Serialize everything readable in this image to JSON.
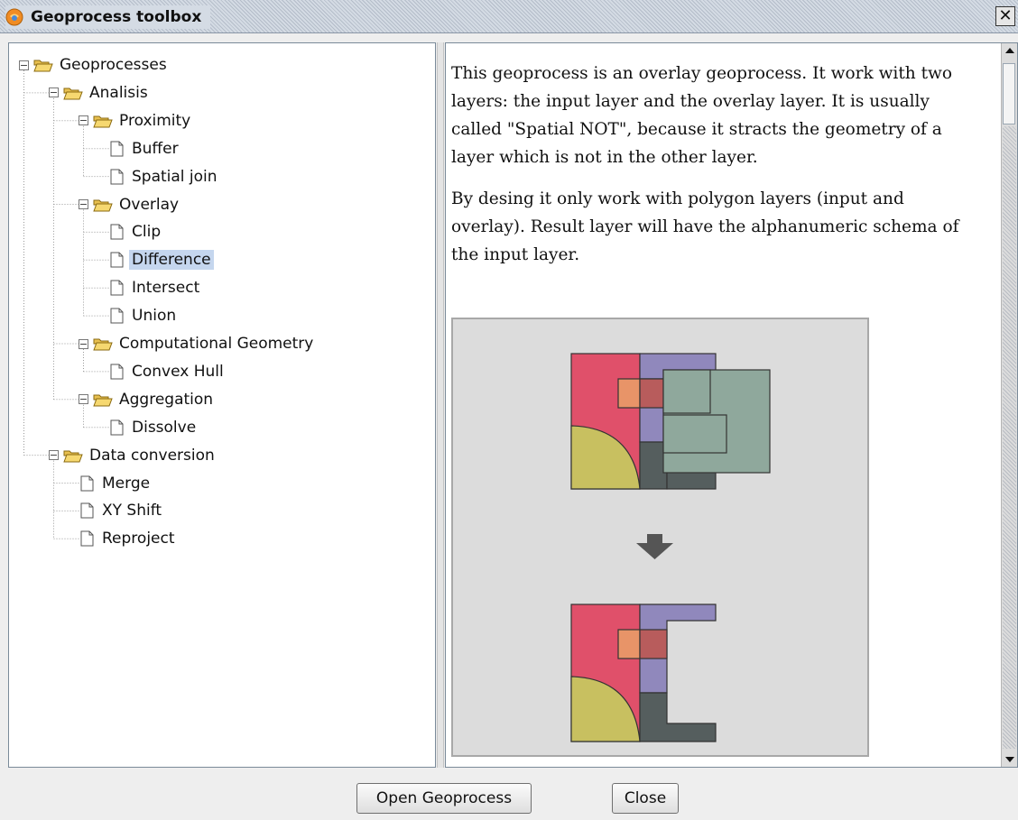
{
  "window": {
    "title": "Geoprocess toolbox",
    "close_glyph": "✕"
  },
  "tree": [
    {
      "id": "geoprocesses",
      "label": "Geoprocesses",
      "kind": "folder",
      "level": 0,
      "expanded": true
    },
    {
      "id": "analisis",
      "label": "Analisis",
      "kind": "folder",
      "level": 1,
      "expanded": true
    },
    {
      "id": "proximity",
      "label": "Proximity",
      "kind": "folder",
      "level": 2,
      "expanded": true
    },
    {
      "id": "buffer",
      "label": "Buffer",
      "kind": "leaf",
      "level": 3
    },
    {
      "id": "spatial-join",
      "label": "Spatial join",
      "kind": "leaf",
      "level": 3
    },
    {
      "id": "overlay",
      "label": "Overlay",
      "kind": "folder",
      "level": 2,
      "expanded": true
    },
    {
      "id": "clip",
      "label": "Clip",
      "kind": "leaf",
      "level": 3
    },
    {
      "id": "difference",
      "label": "Difference",
      "kind": "leaf",
      "level": 3,
      "selected": true
    },
    {
      "id": "intersect",
      "label": "Intersect",
      "kind": "leaf",
      "level": 3
    },
    {
      "id": "union",
      "label": "Union",
      "kind": "leaf",
      "level": 3
    },
    {
      "id": "computational-geometry",
      "label": "Computational Geometry",
      "kind": "folder",
      "level": 2,
      "expanded": true
    },
    {
      "id": "convex-hull",
      "label": "Convex Hull",
      "kind": "leaf",
      "level": 3
    },
    {
      "id": "aggregation",
      "label": "Aggregation",
      "kind": "folder",
      "level": 2,
      "expanded": true
    },
    {
      "id": "dissolve",
      "label": "Dissolve",
      "kind": "leaf",
      "level": 3
    },
    {
      "id": "data-conversion",
      "label": "Data conversion",
      "kind": "folder",
      "level": 1,
      "expanded": true
    },
    {
      "id": "merge",
      "label": "Merge",
      "kind": "leaf",
      "level": 2
    },
    {
      "id": "xy-shift",
      "label": "XY Shift",
      "kind": "leaf",
      "level": 2
    },
    {
      "id": "reproject",
      "label": "Reproject",
      "kind": "leaf",
      "level": 2
    }
  ],
  "help": {
    "paragraph1": "This geoprocess is an overlay geoprocess. It work with two layers: the input layer and the overlay layer. It is usually called \"Spatial NOT\", because it stracts the geometry of a layer which is not in the other layer.",
    "paragraph2": "By desing it only work with polygon layers (input and overlay). Result layer will have the alphanumeric schema of the input layer."
  },
  "buttons": {
    "open": "Open Geoprocess",
    "close": "Close"
  },
  "colors": {
    "selection": "#c5d6ee",
    "input_red": "#e0506a",
    "input_purple": "#9088bc",
    "input_orange": "#e89468",
    "input_brown": "#b85c5c",
    "input_yellow": "#c8c060",
    "input_dark": "#555e5e",
    "overlay_green": "#8fa89c",
    "arrow": "#555555"
  },
  "icons": {
    "app": "geoprocess-app-icon",
    "folder": "open-folder-icon",
    "leaf": "document-icon",
    "expander": "collapse-minus-icon"
  }
}
